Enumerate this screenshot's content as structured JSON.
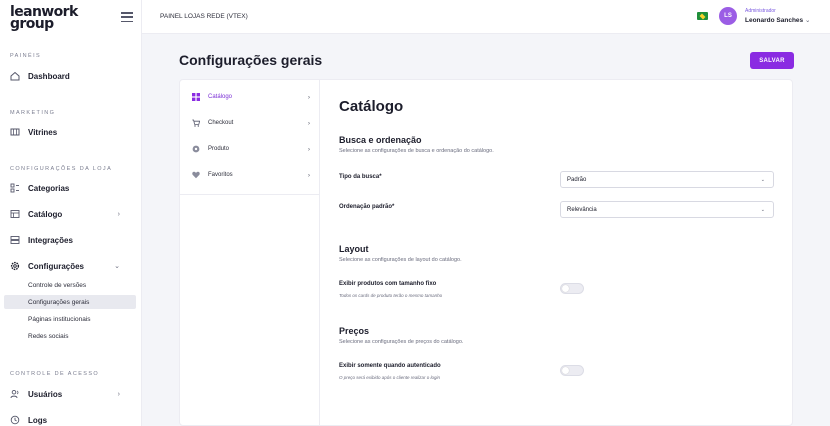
{
  "sidebar": {
    "logo_line1": "leanwork",
    "logo_line2": "group",
    "sections": {
      "paineis": "PAINÉIS",
      "marketing": "MARKETING",
      "config_loja": "CONFIGURAÇÕES DA LOJA",
      "controle": "CONTROLE DE ACESSO"
    },
    "items": {
      "dashboard": "Dashboard",
      "vitrines": "Vitrines",
      "categorias": "Categorias",
      "catalogo": "Catálogo",
      "integracoes": "Integrações",
      "configuracoes": "Configurações",
      "usuarios": "Usuários",
      "logs": "Logs"
    },
    "sub_items": {
      "controle_versoes": "Controle de versões",
      "config_gerais": "Configurações gerais",
      "paginas": "Páginas institucionais",
      "redes": "Redes sociais"
    }
  },
  "topbar": {
    "breadcrumb": "PAINEL LOJAS REDE (VTEX)",
    "avatar_initials": "LS",
    "role": "Administrador",
    "user_name": "Leonardo Sanches",
    "user_chevron": "⌄"
  },
  "page": {
    "title": "Configurações gerais",
    "save_label": "SALVAR"
  },
  "settings_menu": {
    "catalogo": "Catálogo",
    "checkout": "Checkout",
    "produto": "Produto",
    "favoritos": "Favoritos"
  },
  "catalog": {
    "title": "Catálogo",
    "busca": {
      "heading": "Busca e ordenação",
      "description": "Selecione as configurações de busca e ordenação do catálogo.",
      "tipo_label": "Tipo da busca*",
      "tipo_value": "Padrão",
      "ordem_label": "Ordenação padrão*",
      "ordem_value": "Relevância"
    },
    "layout": {
      "heading": "Layout",
      "description": "Selecione as configurações de layout do catálogo.",
      "toggle_label": "Exibir produtos com tamanho fixo",
      "toggle_hint": "Todos os cards de produto terão o mesmo tamanho",
      "toggle_on": false
    },
    "precos": {
      "heading": "Preços",
      "description": "Selecione as configurações de preços do catálogo.",
      "toggle_label": "Exibir somente quando autenticado",
      "toggle_hint": "O preço será exibido após o cliente realizar o login",
      "toggle_on": false
    }
  },
  "colors": {
    "accent": "#8a2be2",
    "avatar": "#9b5de5",
    "background": "#f4f5f9"
  }
}
